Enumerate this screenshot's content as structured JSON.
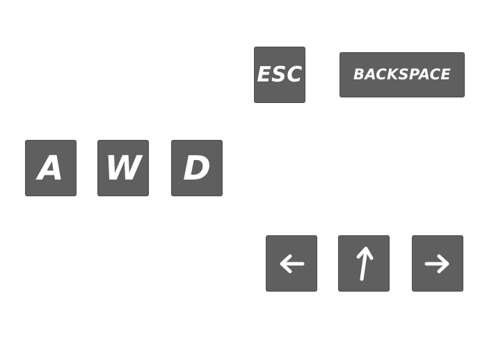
{
  "keys": {
    "esc": "ESC",
    "backspace": "BACKSPACE",
    "a": "A",
    "w": "W",
    "d": "D"
  },
  "arrows": {
    "left": "left-arrow-icon",
    "up": "up-arrow-icon",
    "right": "right-arrow-icon"
  },
  "colors": {
    "key_fill": "#5f5f5f",
    "key_border": "#4a4a4a",
    "key_text": "#ffffff",
    "background": "#ffffff"
  }
}
